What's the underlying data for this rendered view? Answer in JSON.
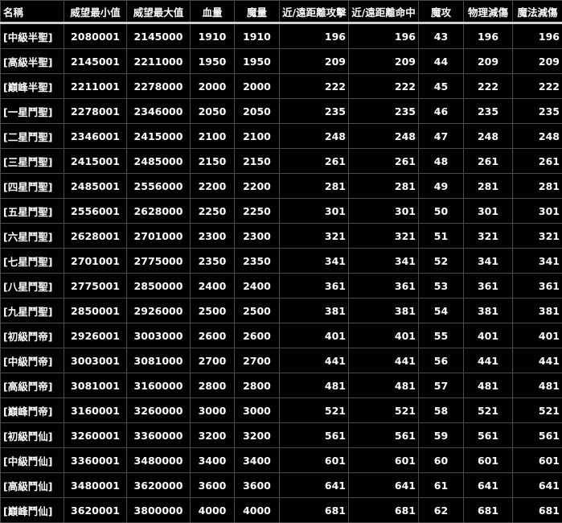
{
  "table": {
    "headers": [
      "名稱",
      "威望最小值",
      "威望最大值",
      "血量",
      "魔量",
      "近/遠距離攻擊",
      "近/遠距離命中",
      "魔攻",
      "物理減傷",
      "魔法減傷"
    ],
    "rows": [
      [
        "[中級半聖]",
        "2080001",
        "2145000",
        "1910",
        "1910",
        "196",
        "196",
        "43",
        "196",
        "196"
      ],
      [
        "[高級半聖]",
        "2145001",
        "2211000",
        "1950",
        "1950",
        "209",
        "209",
        "44",
        "209",
        "209"
      ],
      [
        "[巔峰半聖]",
        "2211001",
        "2278000",
        "2000",
        "2000",
        "222",
        "222",
        "45",
        "222",
        "222"
      ],
      [
        "[一星鬥聖]",
        "2278001",
        "2346000",
        "2050",
        "2050",
        "235",
        "235",
        "46",
        "235",
        "235"
      ],
      [
        "[二星鬥聖]",
        "2346001",
        "2415000",
        "2100",
        "2100",
        "248",
        "248",
        "47",
        "248",
        "248"
      ],
      [
        "[三星鬥聖]",
        "2415001",
        "2485000",
        "2150",
        "2150",
        "261",
        "261",
        "48",
        "261",
        "261"
      ],
      [
        "[四星鬥聖]",
        "2485001",
        "2556000",
        "2200",
        "2200",
        "281",
        "281",
        "49",
        "281",
        "281"
      ],
      [
        "[五星鬥聖]",
        "2556001",
        "2628000",
        "2250",
        "2250",
        "301",
        "301",
        "50",
        "301",
        "301"
      ],
      [
        "[六星鬥聖]",
        "2628001",
        "2701000",
        "2300",
        "2300",
        "321",
        "321",
        "51",
        "321",
        "321"
      ],
      [
        "[七星鬥聖]",
        "2701001",
        "2775000",
        "2350",
        "2350",
        "341",
        "341",
        "52",
        "341",
        "341"
      ],
      [
        "[八星鬥聖]",
        "2775001",
        "2850000",
        "2400",
        "2400",
        "361",
        "361",
        "53",
        "361",
        "361"
      ],
      [
        "[九星鬥聖]",
        "2850001",
        "2926000",
        "2500",
        "2500",
        "381",
        "381",
        "54",
        "381",
        "381"
      ],
      [
        "[初級鬥帝]",
        "2926001",
        "3003000",
        "2600",
        "2600",
        "401",
        "401",
        "55",
        "401",
        "401"
      ],
      [
        "[中級鬥帝]",
        "3003001",
        "3081000",
        "2700",
        "2700",
        "441",
        "441",
        "56",
        "441",
        "441"
      ],
      [
        "[高級鬥帝]",
        "3081001",
        "3160000",
        "2800",
        "2800",
        "481",
        "481",
        "57",
        "481",
        "481"
      ],
      [
        "[巔峰鬥帝]",
        "3160001",
        "3260000",
        "3000",
        "3000",
        "521",
        "521",
        "58",
        "521",
        "521"
      ],
      [
        "[初級鬥仙]",
        "3260001",
        "3360000",
        "3200",
        "3200",
        "561",
        "561",
        "59",
        "561",
        "561"
      ],
      [
        "[中級鬥仙]",
        "3360001",
        "3480000",
        "3400",
        "3400",
        "601",
        "601",
        "60",
        "601",
        "601"
      ],
      [
        "[高級鬥仙]",
        "3480001",
        "3620000",
        "3600",
        "3600",
        "641",
        "641",
        "61",
        "641",
        "641"
      ],
      [
        "[巔峰鬥仙]",
        "3620001",
        "3800000",
        "4000",
        "4000",
        "681",
        "681",
        "62",
        "681",
        "681"
      ]
    ]
  }
}
